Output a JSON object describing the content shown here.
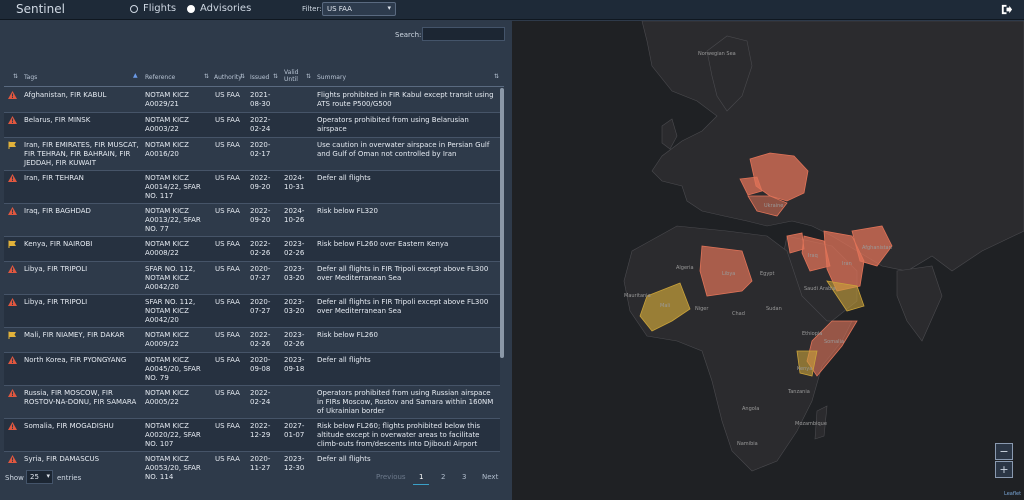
{
  "app": {
    "title": "Sentinel"
  },
  "mode": {
    "flights_label": "Flights",
    "advisories_label": "Advisories",
    "selected": "Advisories"
  },
  "filter": {
    "label": "Filter:",
    "value": "US FAA"
  },
  "search": {
    "label": "Search:",
    "value": ""
  },
  "table": {
    "headers": {
      "tags": "Tags",
      "reference": "Reference",
      "authority": "Authority",
      "issued": "Issued",
      "valid_until": "Valid Until",
      "summary": "Summary"
    },
    "rows": [
      {
        "icon": "warning-red",
        "tags": "Afghanistan, FIR KABUL",
        "reference": "NOTAM KICZ A0029/21",
        "authority": "US FAA",
        "issued": "2021-08-30",
        "valid_until": "",
        "summary": "Flights prohibited in FIR Kabul except transit using ATS route P500/G500"
      },
      {
        "icon": "warning-red",
        "tags": "Belarus, FIR MINSK",
        "reference": "NOTAM KICZ A0003/22",
        "authority": "US FAA",
        "issued": "2022-02-24",
        "valid_until": "",
        "summary": "Operators prohibited from using Belarusian airspace"
      },
      {
        "icon": "flag-yellow",
        "tags": "Iran, FIR EMIRATES, FIR MUSCAT, FIR TEHRAN, FIR BAHRAIN, FIR JEDDAH, FIR KUWAIT",
        "reference": "NOTAM KICZ A0016/20",
        "authority": "US FAA",
        "issued": "2020-02-17",
        "valid_until": "",
        "summary": "Use caution in overwater airspace in Persian Gulf and Gulf of Oman not controlled by Iran"
      },
      {
        "icon": "warning-red",
        "tags": "Iran, FIR TEHRAN",
        "reference": "NOTAM KICZ A0014/22, SFAR NO. 117",
        "authority": "US FAA",
        "issued": "2022-09-20",
        "valid_until": "2024-10-31",
        "summary": "Defer all flights"
      },
      {
        "icon": "warning-red",
        "tags": "Iraq, FIR BAGHDAD",
        "reference": "NOTAM KICZ A0013/22, SFAR NO. 77",
        "authority": "US FAA",
        "issued": "2022-09-20",
        "valid_until": "2024-10-26",
        "summary": "Risk below FL320"
      },
      {
        "icon": "flag-yellow",
        "tags": "Kenya, FIR NAIROBI",
        "reference": "NOTAM KICZ A0008/22",
        "authority": "US FAA",
        "issued": "2022-02-26",
        "valid_until": "2023-02-26",
        "summary": "Risk below FL260 over Eastern Kenya"
      },
      {
        "icon": "warning-red",
        "tags": "Libya, FIR TRIPOLI",
        "reference": "SFAR NO. 112, NOTAM KICZ A0042/20",
        "authority": "US FAA",
        "issued": "2020-07-27",
        "valid_until": "2023-03-20",
        "summary": "Defer all flights in FIR Tripoli except above FL300 over Mediterranean Sea"
      },
      {
        "icon": "warning-red",
        "tags": "Libya, FIR TRIPOLI",
        "reference": "SFAR NO. 112, NOTAM KICZ A0042/20",
        "authority": "US FAA",
        "issued": "2020-07-27",
        "valid_until": "2023-03-20",
        "summary": "Defer all flights in FIR Tripoli except above FL300 over Mediterranean Sea"
      },
      {
        "icon": "flag-yellow",
        "tags": "Mali, FIR NIAMEY, FIR DAKAR",
        "reference": "NOTAM KICZ A0009/22",
        "authority": "US FAA",
        "issued": "2022-02-26",
        "valid_until": "2023-02-26",
        "summary": "Risk below FL260"
      },
      {
        "icon": "warning-red",
        "tags": "North Korea, FIR PYONGYANG",
        "reference": "NOTAM KICZ A0045/20, SFAR NO. 79",
        "authority": "US FAA",
        "issued": "2020-09-08",
        "valid_until": "2023-09-18",
        "summary": "Defer all flights"
      },
      {
        "icon": "warning-red",
        "tags": "Russia, FIR MOSCOW, FIR ROSTOV-NA-DONU, FIR SAMARA",
        "reference": "NOTAM KICZ A0005/22",
        "authority": "US FAA",
        "issued": "2022-02-24",
        "valid_until": "",
        "summary": "Operators prohibited from using Russian airspace in FIRs Moscow, Rostov and Samara within 160NM of Ukrainian border"
      },
      {
        "icon": "warning-red",
        "tags": "Somalia, FIR MOGADISHU",
        "reference": "NOTAM KICZ A0020/22, SFAR NO. 107",
        "authority": "US FAA",
        "issued": "2022-12-29",
        "valid_until": "2027-01-07",
        "summary": "Risk below FL260; flights prohibited below this altitude except in overwater areas to facilitate climb-outs from/descents into Djibouti Airport"
      },
      {
        "icon": "warning-red",
        "tags": "Syria, FIR DAMASCUS",
        "reference": "NOTAM KICZ A0053/20, SFAR NO. 114",
        "authority": "US FAA",
        "issued": "2020-11-27",
        "valid_until": "2023-12-30",
        "summary": "Defer all flights"
      }
    ]
  },
  "pagination": {
    "show_label": "Show",
    "page_size": "25",
    "entries_label": "entries",
    "prev_label": "Previous",
    "pages": [
      "1",
      "2",
      "3"
    ],
    "current": "1",
    "next_label": "Next"
  },
  "map": {
    "zoom_in": "+",
    "zoom_out": "−",
    "attribution": "Leaflet",
    "labels": [
      {
        "text": "Norwegian Sea"
      },
      {
        "text": "Algeria"
      },
      {
        "text": "Libya"
      },
      {
        "text": "Egypt"
      },
      {
        "text": "Mali"
      },
      {
        "text": "Mauritania"
      },
      {
        "text": "Niger"
      },
      {
        "text": "Sudan"
      },
      {
        "text": "Chad"
      },
      {
        "text": "Iran"
      },
      {
        "text": "Iraq"
      },
      {
        "text": "Afghanistan"
      },
      {
        "text": "Ukraine"
      },
      {
        "text": "Saudi Arabia"
      },
      {
        "text": "Ethiopia"
      },
      {
        "text": "Somalia"
      },
      {
        "text": "Kenya"
      },
      {
        "text": "Angola"
      },
      {
        "text": "Namibia"
      },
      {
        "text": "Tanzania"
      },
      {
        "text": "Mozambique"
      }
    ],
    "colors": {
      "restricted": "#e07358",
      "caution": "#c9a23a",
      "land": "#2b2b2e",
      "water": "#1f2124",
      "border": "#4a4a4e"
    }
  }
}
